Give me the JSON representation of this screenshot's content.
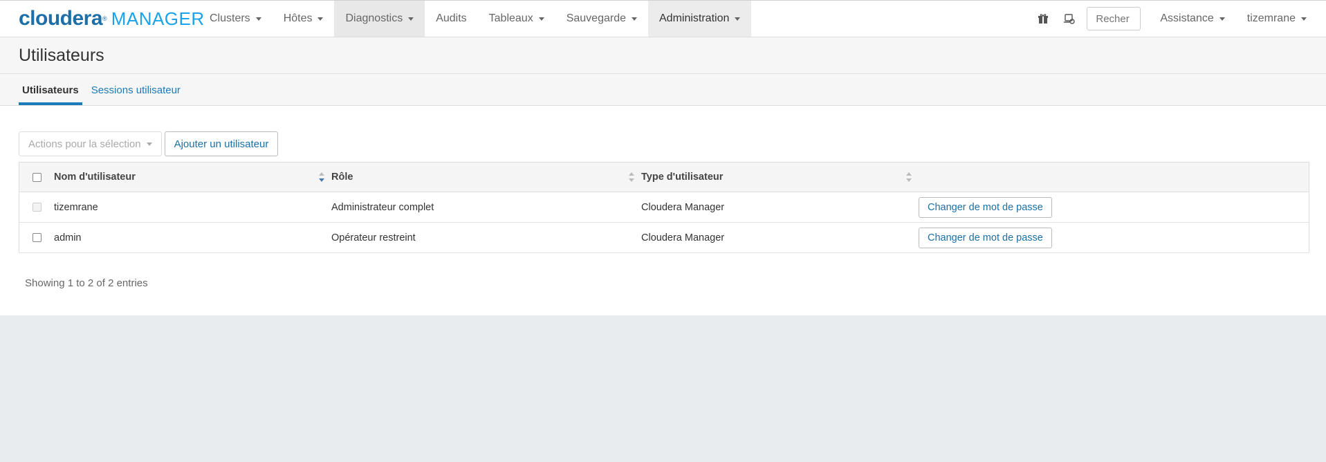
{
  "brand": {
    "name_part1": "cloudera",
    "name_part2": "MANAGER"
  },
  "nav": {
    "items": [
      {
        "label": "Clusters",
        "dropdown": true
      },
      {
        "label": "Hôtes",
        "dropdown": true
      },
      {
        "label": "Diagnostics",
        "dropdown": true
      },
      {
        "label": "Audits",
        "dropdown": false
      },
      {
        "label": "Tableaux",
        "dropdown": true
      },
      {
        "label": "Sauvegarde",
        "dropdown": true
      },
      {
        "label": "Administration",
        "dropdown": true
      }
    ],
    "search_placeholder": "Recher",
    "help_label": "Assistance",
    "user_label": "tizemrane"
  },
  "page": {
    "title": "Utilisateurs"
  },
  "tabs": [
    {
      "label": "Utilisateurs",
      "active": true
    },
    {
      "label": "Sessions utilisateur",
      "active": false
    }
  ],
  "toolbar": {
    "actions_label": "Actions pour la sélection",
    "add_user_label": "Ajouter un utilisateur"
  },
  "table": {
    "headers": {
      "name": "Nom d'utilisateur",
      "role": "Rôle",
      "type": "Type d'utilisateur"
    },
    "rows": [
      {
        "name": "tizemrane",
        "role": "Administrateur complet",
        "type": "Cloudera Manager",
        "action": "Changer de mot de passe"
      },
      {
        "name": "admin",
        "role": "Opérateur restreint",
        "type": "Cloudera Manager",
        "action": "Changer de mot de passe"
      }
    ]
  },
  "footer": {
    "info": "Showing 1 to 2 of 2 entries"
  }
}
